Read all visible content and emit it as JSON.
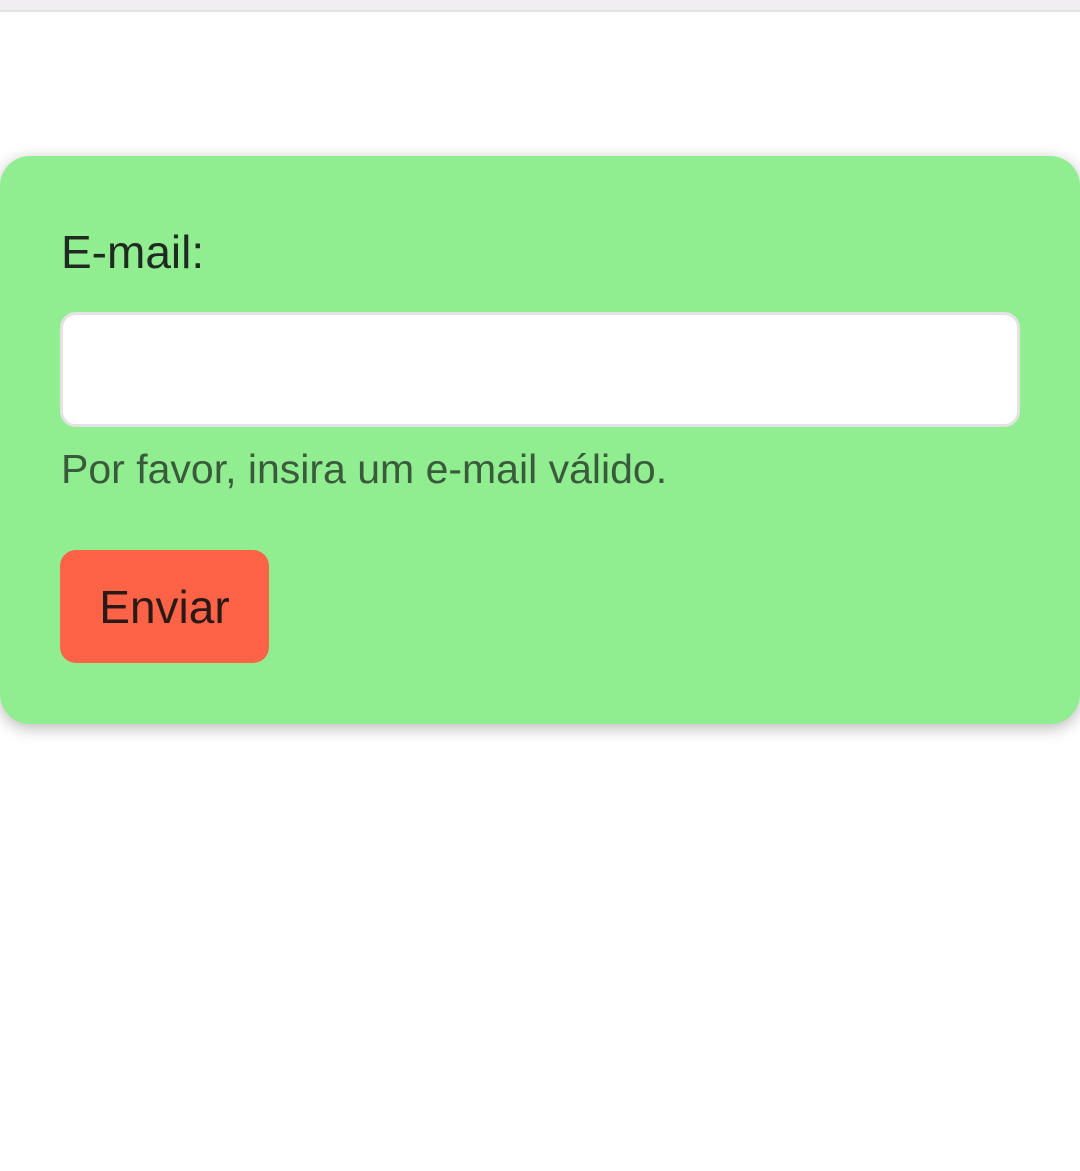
{
  "form": {
    "email_label": "E-mail:",
    "email_value": "",
    "email_placeholder": "",
    "hint": "Por favor, insira um e-mail válido.",
    "submit_label": "Enviar"
  },
  "colors": {
    "card_background": "#90ee90",
    "button_background": "#ff6347"
  }
}
